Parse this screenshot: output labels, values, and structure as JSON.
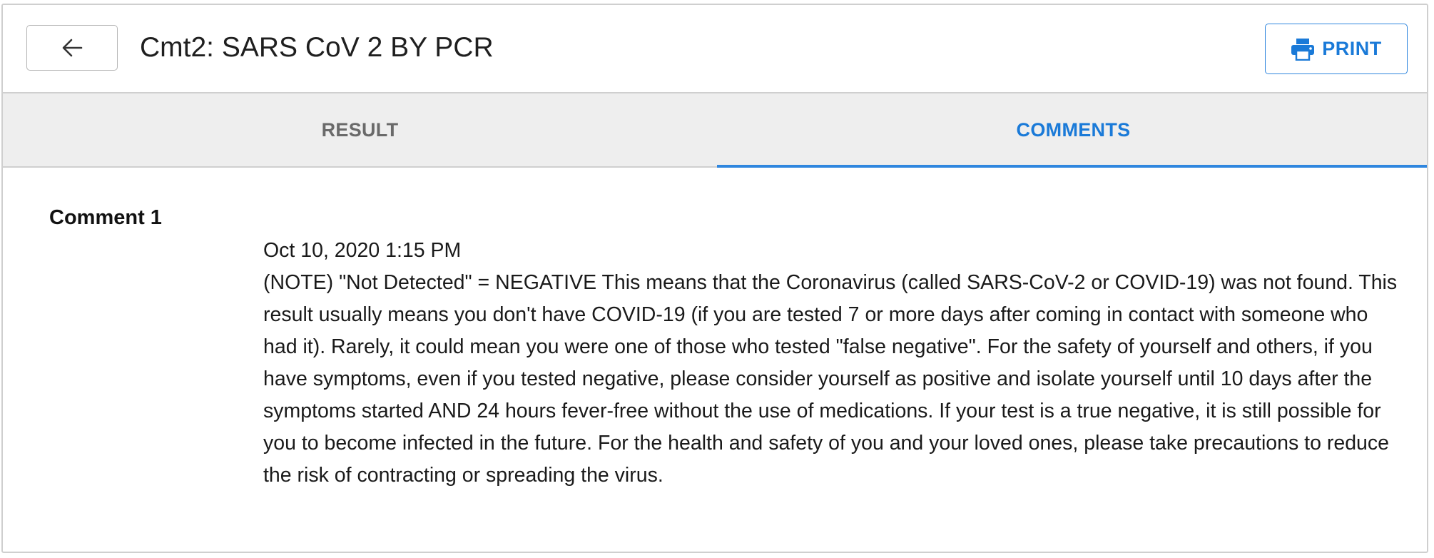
{
  "header": {
    "title": "Cmt2: SARS CoV 2 BY PCR",
    "print_label": "PRINT"
  },
  "tabs": [
    {
      "label": "RESULT",
      "active": false
    },
    {
      "label": "COMMENTS",
      "active": true
    }
  ],
  "comments": [
    {
      "heading": "Comment 1",
      "timestamp": "Oct 10, 2020 1:15 PM",
      "text": "(NOTE) \"Not Detected\" = NEGATIVE This means that the Coronavirus (called SARS-CoV-2 or COVID-19) was not found. This result usually means you don't have COVID-19 (if you are tested 7 or more days after coming in contact with someone who had it). Rarely, it could mean you were one of those who tested \"false negative\". For the safety of yourself and others, if you have symptoms, even if you tested negative, please consider yourself as positive and isolate yourself until 10 days after the symptoms started AND 24 hours fever-free without the use of medications. If your test is a true negative, it is still possible for you to become infected in the future. For the health and safety of you and your loved ones, please take precautions to reduce the risk of contracting or spreading the virus."
    }
  ],
  "icons": {
    "back": "arrow-left-icon",
    "print": "printer-icon"
  },
  "colors": {
    "accent": "#1a7ad8",
    "tab_bar_bg": "#eeeeee",
    "inactive_tab": "#6a6a6a",
    "border": "#cfcfcf"
  }
}
